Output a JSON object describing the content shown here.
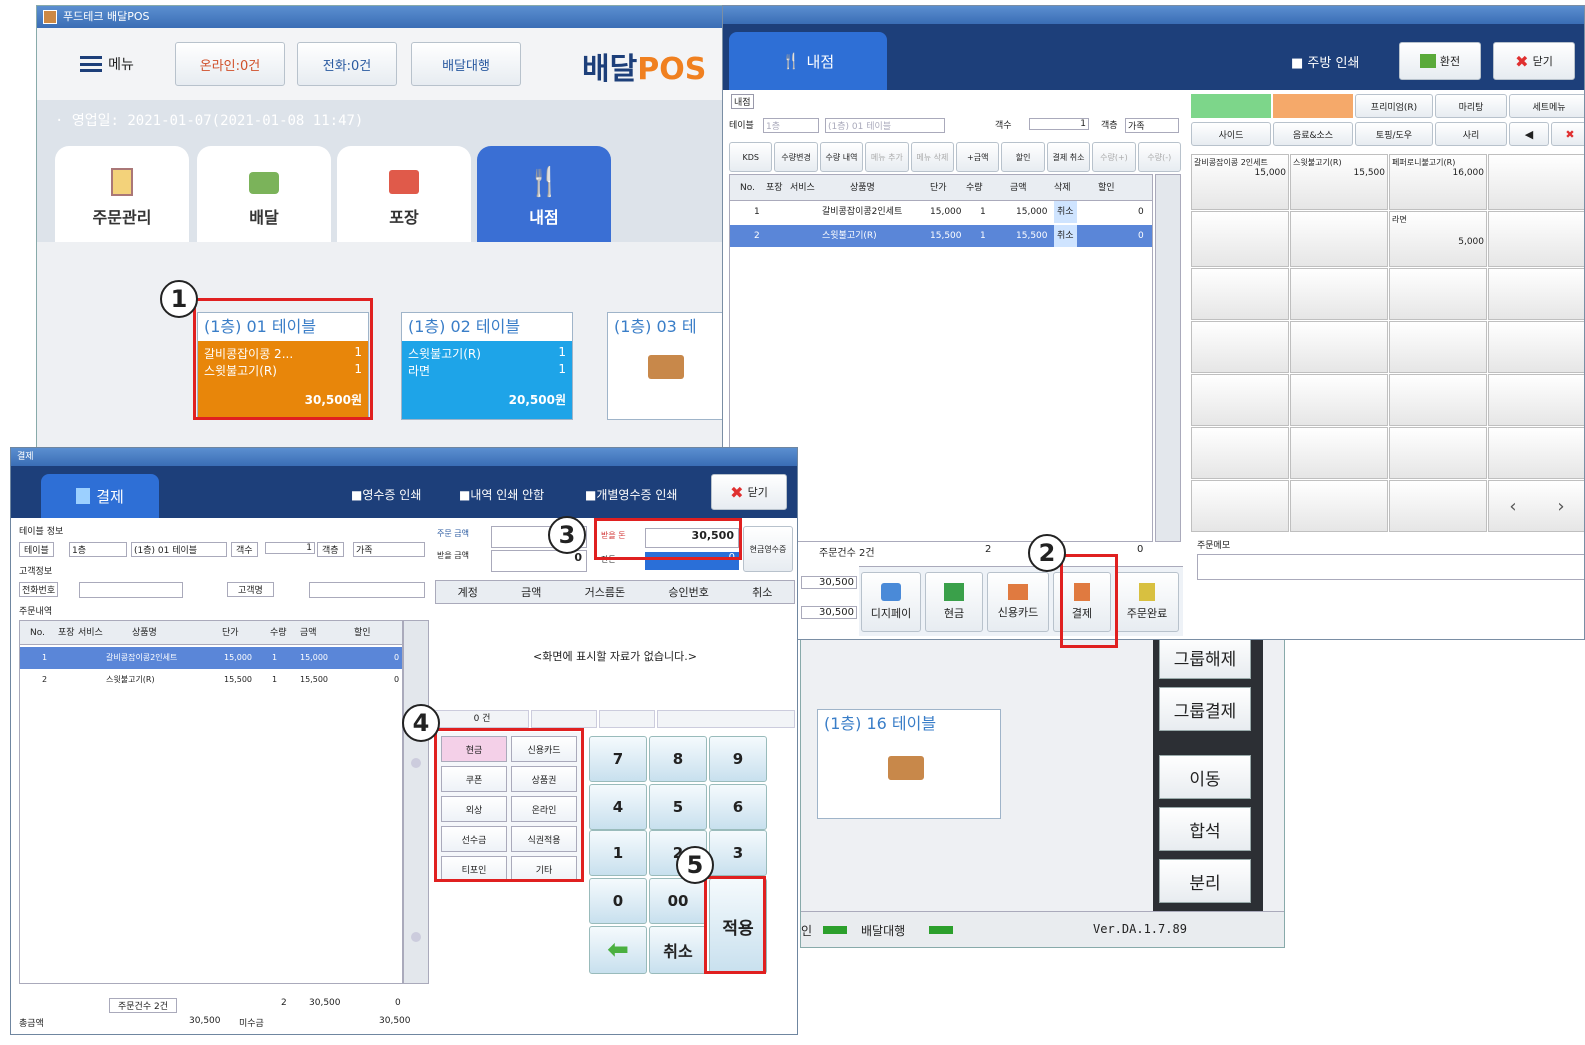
{
  "pos_window": {
    "title": "푸드테크 배달POS",
    "menu_label": "메뉴",
    "online_btn": "온라인:0건",
    "phone_btn": "전화:0건",
    "delivery_agent_btn": "배달대행",
    "brand_prefix": "배달",
    "brand_suffix": "POS",
    "business_day": "· 영업일: 2021-01-07(2021-01-08 11:47)",
    "tabs": [
      {
        "label": "주문관리"
      },
      {
        "label": "배달"
      },
      {
        "label": "포장"
      },
      {
        "label": "내점"
      }
    ],
    "tables": [
      {
        "name": "(1층) 01 테이블",
        "items": [
          {
            "name": "갈비콩잡이콩 2...",
            "qty": "1"
          },
          {
            "name": "스윗불고기(R)",
            "qty": "1"
          }
        ],
        "total": "30,500원"
      },
      {
        "name": "(1층) 02 테이블",
        "items": [
          {
            "name": "스윗불고기(R)",
            "qty": "1"
          },
          {
            "name": "라면",
            "qty": "1"
          }
        ],
        "total": "20,500원"
      },
      {
        "name": "(1층) 03 테",
        "items": [],
        "total": ""
      },
      {
        "name": "(1층) 16 테이블",
        "items": [],
        "total": ""
      }
    ],
    "side_buttons": [
      "그룹해제",
      "그룹결제",
      "이동",
      "합석",
      "분리"
    ],
    "status": {
      "delivery_agent": "배달대행",
      "version": "Ver.DA.1.7.89",
      "left": "인"
    }
  },
  "store_window": {
    "tab_label": "내점",
    "kitchen_print": "주방 인쇄",
    "exchange_btn": "환전",
    "close_btn": "닫기",
    "section_label": "내점",
    "table_label": "테이블",
    "table_floor": "1층",
    "table_name": "(1층) 01 테이블",
    "guest_label": "객수",
    "guest_value": "1",
    "guest_type_label": "객층",
    "guest_type_value": "가족",
    "toolbar": [
      "KDS",
      "수량변경",
      "수량 내역",
      "메뉴 추가",
      "메뉴 삭제",
      "+금액",
      "할인",
      "결제 취소",
      "수량(+)",
      "수량(-)"
    ],
    "col_headers": [
      "No.",
      "포장",
      "서비스",
      "상품명",
      "단가",
      "수량",
      "금액",
      "삭제",
      "할인"
    ],
    "rows": [
      {
        "no": "1",
        "name": "갈비콩잡이콩2인세트",
        "price": "15,000",
        "qty": "1",
        "amount": "15,000",
        "del": "취소",
        "disc": "0"
      },
      {
        "no": "2",
        "name": "스윗불고기(R)",
        "price": "15,500",
        "qty": "1",
        "amount": "15,500",
        "del": "취소",
        "disc": "0"
      }
    ],
    "order_count": "주문건수 2건",
    "order_qty": "2",
    "order_disc": "0",
    "sum1": "30,500",
    "sum2": "30,500",
    "categories_top": [
      "",
      "",
      "프리미엄(R)",
      "마리탕",
      "세트메뉴"
    ],
    "categories_second": [
      "사이드",
      "음료&소스",
      "토핑/도우",
      "사리"
    ],
    "menu_items": [
      {
        "name": "갈비콩잡이콩 2인세트",
        "price": "15,000"
      },
      {
        "name": "스윗불고기(R)",
        "price": "15,500"
      },
      {
        "name": "페퍼로니불고기(R)",
        "price": "16,000"
      },
      {
        "name": "라면",
        "price": "5,000"
      }
    ],
    "memo_label": "주문메모",
    "pay_buttons": [
      "디지페이",
      "현금",
      "신용카드",
      "결제",
      "주문완료"
    ]
  },
  "payment_window": {
    "title": "결제",
    "header": "결제",
    "opt1": "영수증 인쇄",
    "opt2": "내역 인쇄 안함",
    "opt3": "개별영수증 인쇄",
    "close_btn": "닫기",
    "table_info_label": "테이블 정보",
    "table_label": "테이블",
    "table_floor": "1층",
    "table_name": "(1층) 01 테이블",
    "guest_label": "객수",
    "guest_value": "1",
    "guest_type_label": "객층",
    "guest_type_value": "가족",
    "customer_info": "고객정보",
    "phone_label": "전화번호",
    "grade_label": "고객명",
    "order_detail": "주문내역",
    "col_headers": [
      "No.",
      "포장",
      "서비스",
      "상품명",
      "단가",
      "수량",
      "금액",
      "할인"
    ],
    "rows": [
      {
        "no": "1",
        "name": "갈비콩잡이콩2인세트",
        "price": "15,000",
        "qty": "1",
        "amount": "15,000",
        "disc": "0"
      },
      {
        "no": "2",
        "name": "스윗불고기(R)",
        "price": "15,500",
        "qty": "1",
        "amount": "15,500",
        "disc": "0"
      }
    ],
    "footer_count": "주문건수 2건",
    "footer_qty": "2",
    "footer_amount": "30,500",
    "footer_disc": "0",
    "total_label": "총금액",
    "total_value": "30,500",
    "unpaid_label": "미수금",
    "unpaid_value": "30,500",
    "order_amount_label": "주문 금액",
    "order_amount": "30",
    "pay_amount_label": "받을 금액",
    "pay_amount": "0",
    "received_label": "받을 돈",
    "received_value": "30,500",
    "change_label": "잔돈",
    "change_value": "0",
    "cash_btn": "현금영수증",
    "table_headers": [
      "계정",
      "금액",
      "거스름돈",
      "승인번호",
      "취소"
    ],
    "empty_msg": "<화면에 표시할 자료가 없습니다.>",
    "count": "0 건",
    "method_buttons": [
      "현금",
      "신용카드",
      "쿠폰",
      "상품권",
      "외상",
      "온라인",
      "선수금",
      "식권적용",
      "티포인",
      "기타"
    ],
    "keys": [
      "7",
      "8",
      "9",
      "4",
      "5",
      "6",
      "1",
      "2",
      "3",
      "0",
      "00"
    ],
    "cancel_key": "취소",
    "apply_key": "적용"
  },
  "markers": [
    "1",
    "2",
    "3",
    "4",
    "5"
  ]
}
